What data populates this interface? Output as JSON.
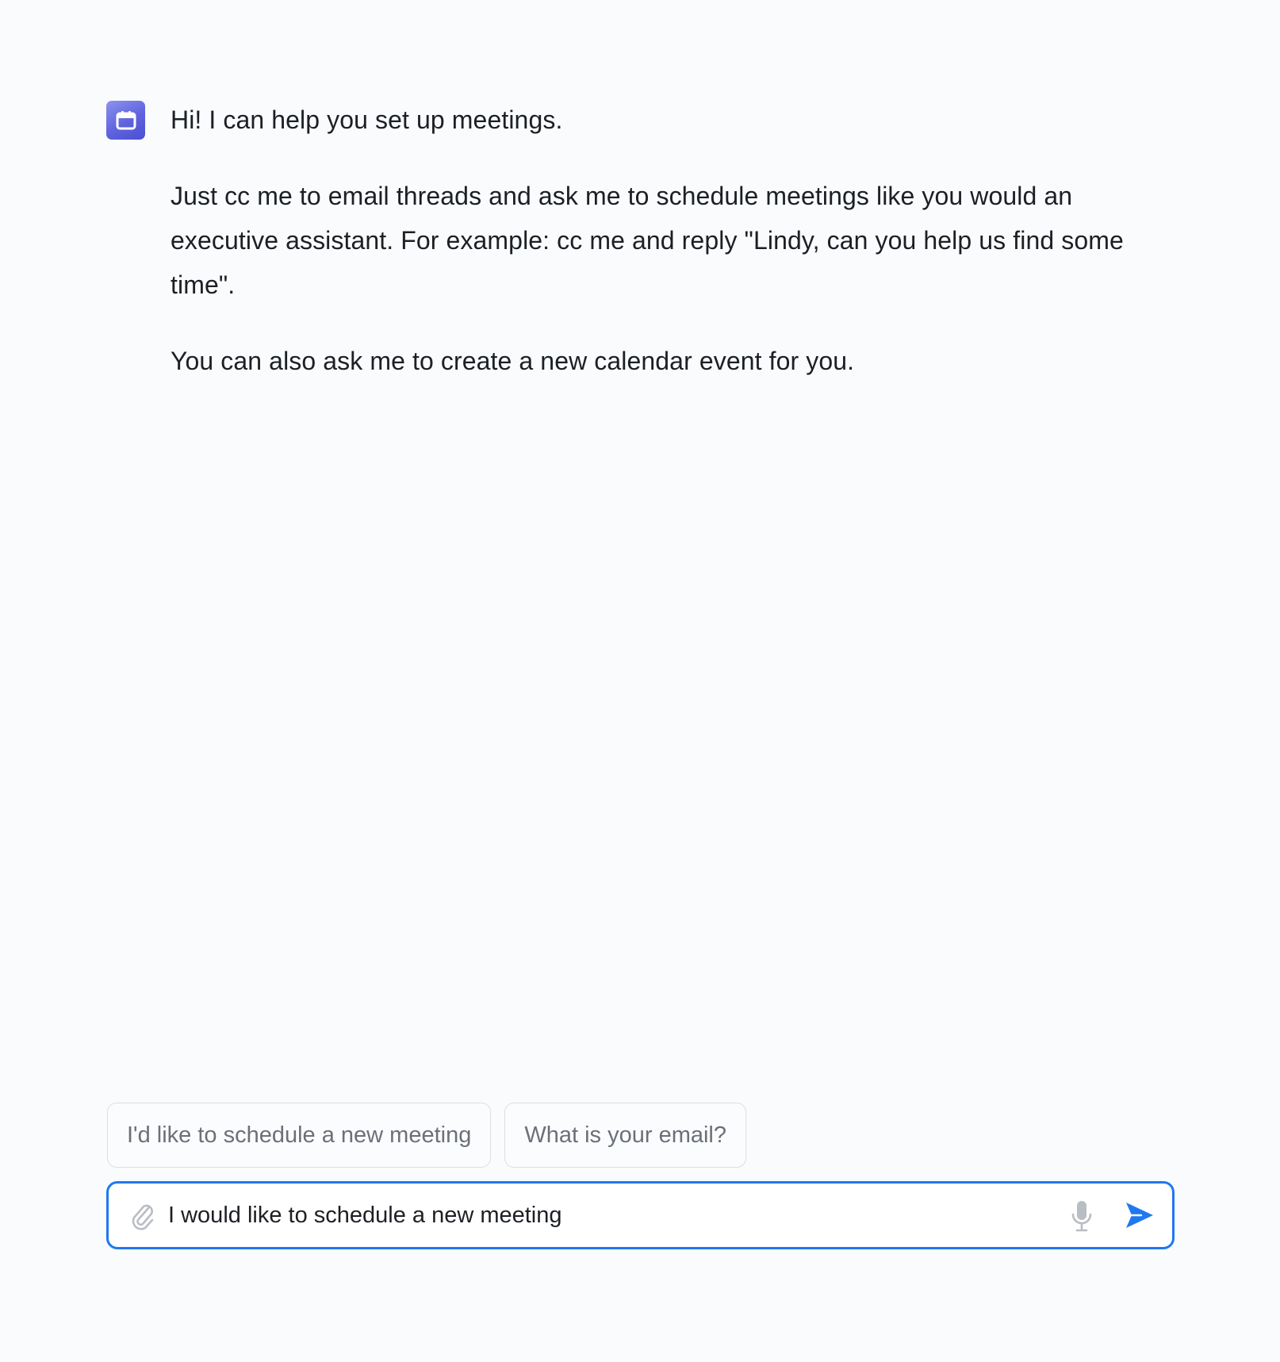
{
  "colors": {
    "background": "#f9fbfd",
    "accent": "#1f78f0",
    "avatar_gradient_start": "#8c93ee",
    "avatar_gradient_end": "#4a4fd3"
  },
  "assistant": {
    "avatar_icon": "calendar-icon",
    "messages": [
      "Hi! I can help you set up meetings.",
      "Just cc me to email threads and ask me to schedule meetings like you would an executive assistant. For example: cc me and reply \"Lindy, can you help us find some time\".",
      "You can also ask me to create a new calendar event for you."
    ]
  },
  "suggestions": [
    "I'd like to schedule a new meeting",
    "What is your email?"
  ],
  "composer": {
    "value": "I would like to schedule a new meeting",
    "attach_icon": "paperclip-icon",
    "mic_icon": "microphone-icon",
    "send_icon": "send-icon"
  }
}
